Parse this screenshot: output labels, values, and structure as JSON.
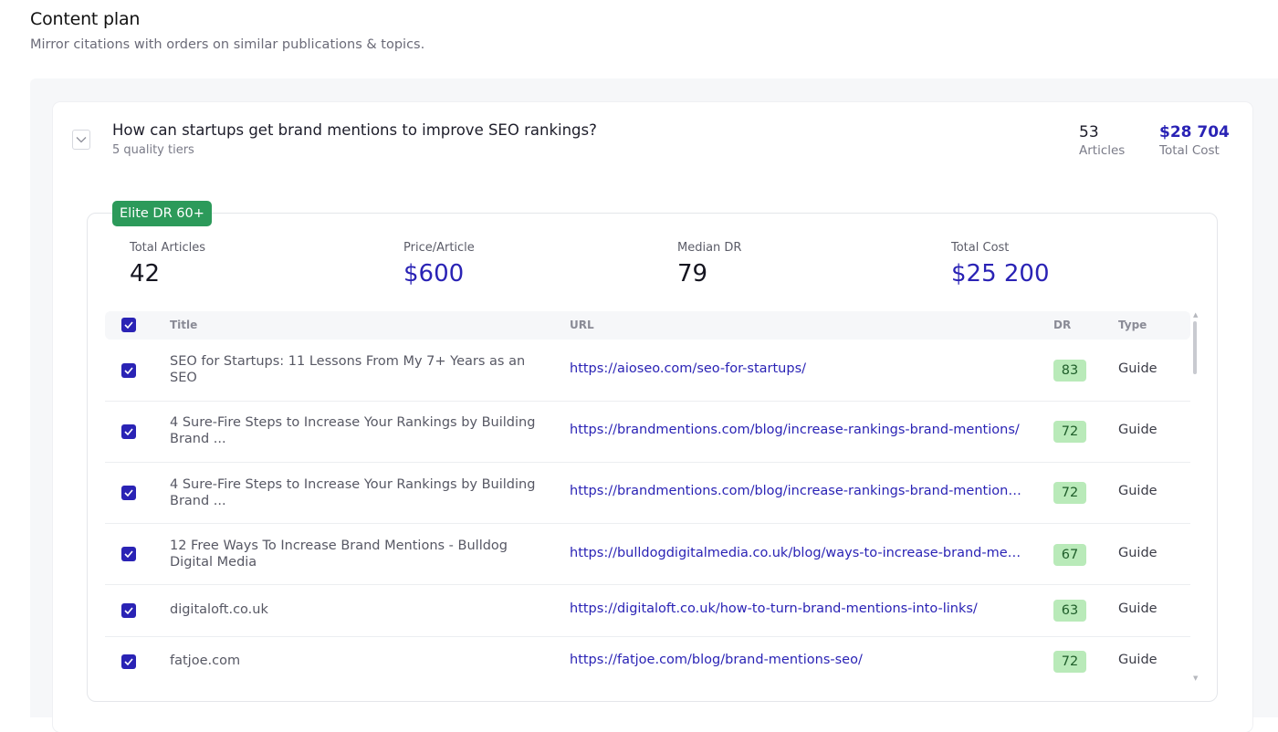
{
  "page": {
    "title": "Content plan",
    "subtitle": "Mirror citations with orders on similar publications & topics."
  },
  "question": {
    "title": "How can startups get brand mentions to improve SEO rankings?",
    "subtitle": "5 quality tiers",
    "articles_value": "53",
    "articles_label": "Articles",
    "cost_value": "$28 704",
    "cost_label": "Total Cost"
  },
  "tier": {
    "badge": "Elite DR 60+",
    "stats": [
      {
        "label": "Total Articles",
        "value": "42"
      },
      {
        "label": "Price/Article",
        "value": "$600"
      },
      {
        "label": "Median DR",
        "value": "79"
      },
      {
        "label": "Total Cost",
        "value": "$25 200"
      }
    ]
  },
  "table": {
    "columns": {
      "title": "Title",
      "url": "URL",
      "dr": "DR",
      "type": "Type"
    },
    "rows": [
      {
        "title": "SEO for Startups: 11 Lessons From My 7+ Years as an SEO",
        "url": "https://aioseo.com/seo-for-startups/",
        "dr": "83",
        "type": "Guide",
        "checked": true
      },
      {
        "title": "4 Sure-Fire Steps to Increase Your Rankings by Building Brand ...",
        "url": "https://brandmentions.com/blog/increase-rankings-brand-mentions/",
        "dr": "72",
        "type": "Guide",
        "checked": true
      },
      {
        "title": "4 Sure-Fire Steps to Increase Your Rankings by Building Brand ...",
        "url": "https://brandmentions.com/blog/increase-rankings-brand-mentions/...",
        "dr": "72",
        "type": "Guide",
        "checked": true
      },
      {
        "title": "12 Free Ways To Increase Brand Mentions - Bulldog Digital Media",
        "url": "https://bulldogdigitalmedia.co.uk/blog/ways-to-increase-brand-men...",
        "dr": "67",
        "type": "Guide",
        "checked": true
      },
      {
        "title": "digitaloft.co.uk",
        "url": "https://digitaloft.co.uk/how-to-turn-brand-mentions-into-links/",
        "dr": "63",
        "type": "Guide",
        "checked": true
      },
      {
        "title": "fatjoe.com",
        "url": "https://fatjoe.com/blog/brand-mentions-seo/",
        "dr": "72",
        "type": "Guide",
        "checked": true
      }
    ]
  },
  "colors": {
    "accent": "#2a23b5",
    "tier_green": "#2c9a5a",
    "dr_badge": "#b9eab9"
  }
}
